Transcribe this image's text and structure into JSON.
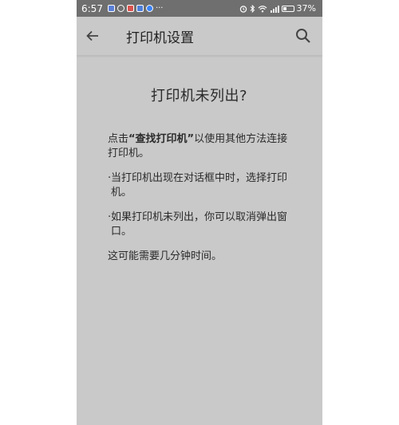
{
  "status_bar": {
    "time": "6:57",
    "more": "···",
    "battery_percent": "37%",
    "battery_level": 0.37
  },
  "app_bar": {
    "title": "打印机设置"
  },
  "main": {
    "heading": "打印机未列出?",
    "para1_prefix": "点击",
    "para1_bold": "“查找打印机”",
    "para1_suffix": "以使用其他方法连接打印机。",
    "bullet1": "当打印机出现在对话框中时，选择打印机。",
    "bullet2": "如果打印机未列出，你可以取消弹出窗口。",
    "para_last": "这可能需要几分钟时间。",
    "bullet_char": "·"
  },
  "colors": {
    "background": "#c9c9c9",
    "status_bar": "#6f6f6f",
    "text": "#2b2b2b"
  }
}
